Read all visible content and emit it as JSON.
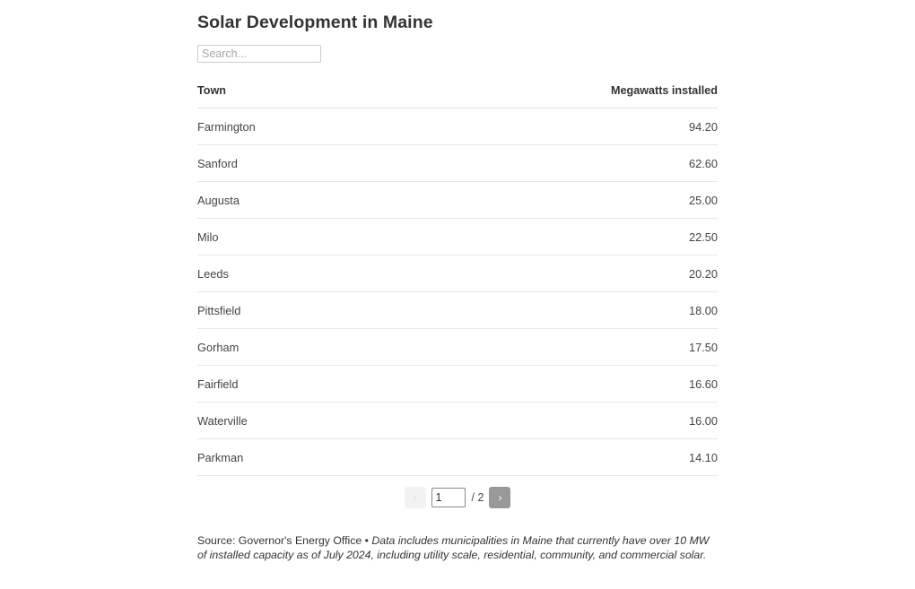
{
  "page": {
    "title": "Solar Development in Maine"
  },
  "search": {
    "placeholder": "Search...",
    "value": ""
  },
  "table": {
    "columns": [
      {
        "key": "town",
        "label": "Town",
        "align": "left"
      },
      {
        "key": "megawatts",
        "label": "Megawatts installed",
        "align": "right"
      }
    ],
    "rows": [
      {
        "town": "Farmington",
        "megawatts": "94.20"
      },
      {
        "town": "Sanford",
        "megawatts": "62.60"
      },
      {
        "town": "Augusta",
        "megawatts": "25.00"
      },
      {
        "town": "Milo",
        "megawatts": "22.50"
      },
      {
        "town": "Leeds",
        "megawatts": "20.20"
      },
      {
        "town": "Pittsfield",
        "megawatts": "18.00"
      },
      {
        "town": "Gorham",
        "megawatts": "17.50"
      },
      {
        "town": "Fairfield",
        "megawatts": "16.60"
      },
      {
        "town": "Waterville",
        "megawatts": "16.00"
      },
      {
        "town": "Parkman",
        "megawatts": "14.10"
      }
    ]
  },
  "pagination": {
    "prev_label": "‹",
    "prev_icon": "chevron-left-icon",
    "prev_disabled": true,
    "next_label": "›",
    "next_icon": "chevron-right-icon",
    "next_disabled": false,
    "current_page": "1",
    "total_label": "/ 2",
    "total_pages": "2"
  },
  "footer": {
    "source": "Source: Governor's Energy Office • ",
    "note": "Data includes municipalities in Maine that currently have over 10 MW of installed capacity as of July 2024, including utility scale, residential, community, and commercial solar."
  },
  "colors": {
    "text": "#333333",
    "row_border": "#e8e8e8",
    "header_border": "#e2e2e2",
    "button_active_bg": "#999999",
    "button_disabled_bg": "#f2f2f2"
  },
  "chart_data": {
    "type": "table",
    "title": "Solar Development in Maine",
    "columns": [
      "Town",
      "Megawatts installed"
    ],
    "categories": [
      "Farmington",
      "Sanford",
      "Augusta",
      "Milo",
      "Leeds",
      "Pittsfield",
      "Gorham",
      "Fairfield",
      "Waterville",
      "Parkman"
    ],
    "values": [
      94.2,
      62.6,
      25.0,
      22.5,
      20.2,
      18.0,
      17.5,
      16.6,
      16.0,
      14.1
    ],
    "xlabel": "Town",
    "ylabel": "Megawatts installed",
    "page": 1,
    "total_pages": 2,
    "rows_per_page": 10,
    "sort": "descending by megawatts installed"
  }
}
